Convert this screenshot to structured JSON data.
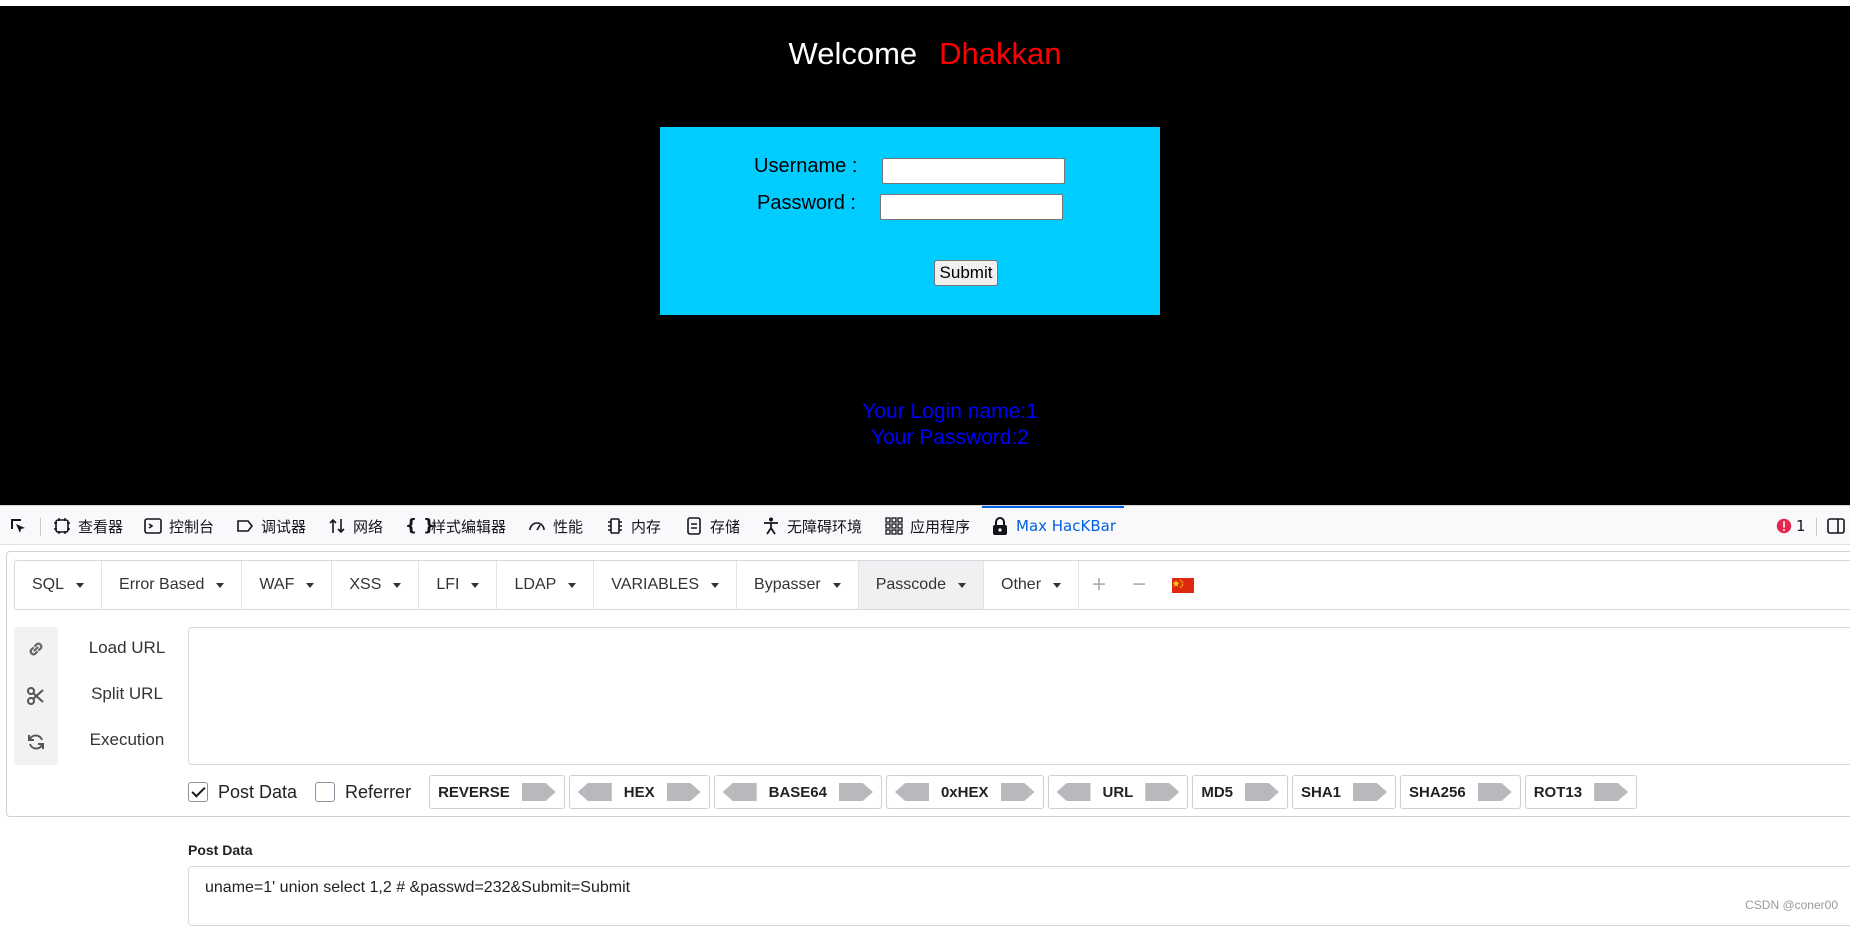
{
  "page": {
    "welcome": "Welcome",
    "user_name": "Dhakkan",
    "username_label": "Username :",
    "password_label": "Password :",
    "submit_label": "Submit",
    "login_name_result": "Your Login name:1",
    "password_result": "Your Password:2"
  },
  "devtools": {
    "tabs": [
      "查看器",
      "控制台",
      "调试器",
      "网络",
      "样式编辑器",
      "性能",
      "内存",
      "存储",
      "无障碍环境",
      "应用程序",
      "Max HacKBar"
    ],
    "error_count": "1"
  },
  "hackbar": {
    "menu": [
      "SQL",
      "Error Based",
      "WAF",
      "XSS",
      "LFI",
      "LDAP",
      "VARIABLES",
      "Bypasser",
      "Passcode",
      "Other"
    ],
    "active_menu": "Passcode",
    "plus": "+",
    "minus": "−",
    "flag": "🇨🇳",
    "load_url": "Load URL",
    "split_url": "Split URL",
    "execution": "Execution",
    "url_value": "",
    "post_data_label": "Post Data",
    "referrer_label": "Referrer",
    "encoders": [
      "REVERSE",
      "HEX",
      "BASE64",
      "0xHEX",
      "URL",
      "MD5",
      "SHA1",
      "SHA256",
      "ROT13"
    ],
    "post_data_title": "Post Data",
    "post_data_value": "uname=1' union select 1,2 # &passwd=232&Submit=Submit"
  },
  "watermark": "CSDN @coner00",
  "colors": {
    "page_bg": "#000000",
    "login_box": "#00ccff",
    "name_red": "#ff0000",
    "result_blue": "#0000ff",
    "devtools_active": "#0061e0"
  }
}
